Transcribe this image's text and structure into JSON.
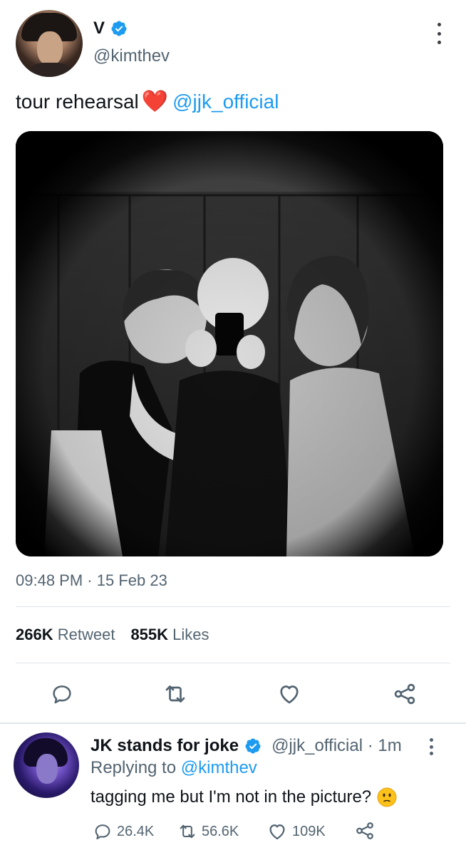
{
  "tweet": {
    "display_name": "V",
    "handle": "@kimthev",
    "text_before": "tour rehearsal",
    "emoji": "❤️",
    "mention": "@jjk_official",
    "time": "09:48 PM",
    "dot": "·",
    "date": "15 Feb 23",
    "stats": {
      "retweets_count": "266K",
      "retweets_label": "Retweet",
      "likes_count": "855K",
      "likes_label": "Likes"
    },
    "icons": [
      "reply-icon",
      "retweet-icon",
      "like-icon",
      "share-icon",
      "more-icon",
      "verified-icon"
    ]
  },
  "reply": {
    "display_name": "JK stands for joke",
    "handle": "@jjk_official",
    "dot": "·",
    "time": "1m",
    "replying_to_label": "Replying to",
    "replying_to_handle": "@kimthev",
    "text": "tagging me but I'm not in the picture?",
    "emoji_name": "slightly-frowning-face-emoji",
    "counts": {
      "replies": "26.4K",
      "retweets": "56.6K",
      "likes": "109K"
    }
  },
  "colors": {
    "accent": "#1d9bf0",
    "text": "#0f1419",
    "secondary": "#536471",
    "heart": "#e0245e",
    "divider": "#e1e6ea"
  }
}
